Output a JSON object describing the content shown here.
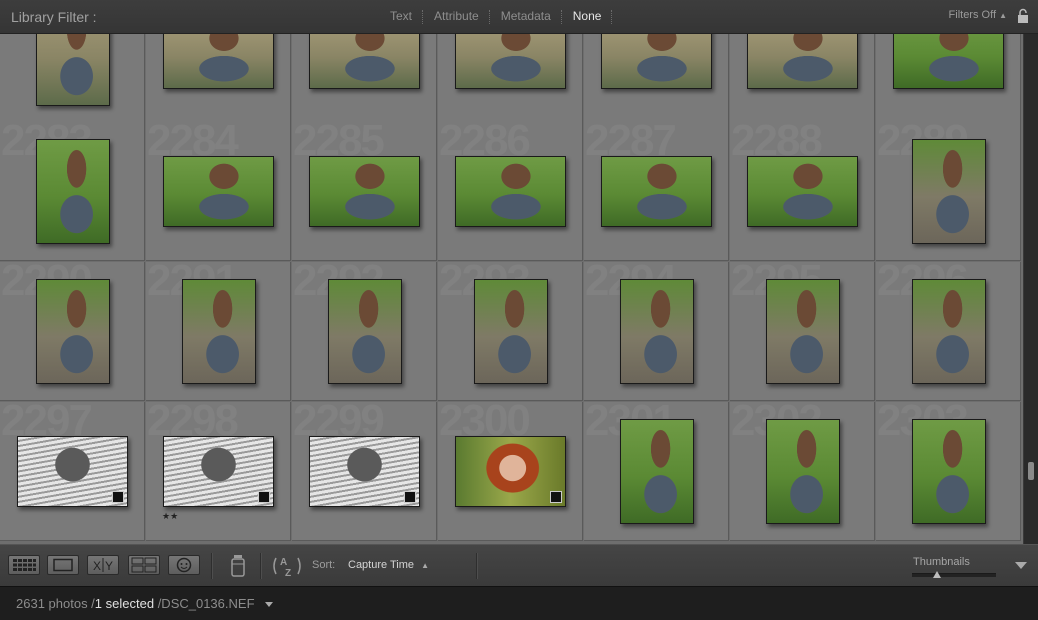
{
  "filter_bar": {
    "title": "Library Filter :",
    "options": [
      "Text",
      "Attribute",
      "Metadata",
      "None"
    ],
    "selected_option": "None",
    "preset": "Filters Off"
  },
  "grid": {
    "rows": [
      [
        {
          "number": "",
          "thumb": "grass",
          "orientation": "portrait",
          "badge": false
        },
        {
          "number": "",
          "thumb": "grass",
          "orientation": "landscape",
          "badge": false
        },
        {
          "number": "",
          "thumb": "grass",
          "orientation": "landscape",
          "badge": false
        },
        {
          "number": "",
          "thumb": "grass",
          "orientation": "landscape",
          "badge": false
        },
        {
          "number": "",
          "thumb": "grass",
          "orientation": "landscape",
          "badge": false
        },
        {
          "number": "",
          "thumb": "grass",
          "orientation": "landscape",
          "badge": false
        },
        {
          "number": "",
          "thumb": "green",
          "orientation": "landscape",
          "badge": false
        }
      ],
      [
        {
          "number": "2283",
          "thumb": "green",
          "orientation": "portrait",
          "badge": false
        },
        {
          "number": "2284",
          "thumb": "green",
          "orientation": "landscape",
          "badge": false
        },
        {
          "number": "2285",
          "thumb": "green",
          "orientation": "landscape",
          "badge": false
        },
        {
          "number": "2286",
          "thumb": "green",
          "orientation": "landscape",
          "badge": false
        },
        {
          "number": "2287",
          "thumb": "green",
          "orientation": "landscape",
          "badge": false
        },
        {
          "number": "2288",
          "thumb": "green",
          "orientation": "landscape",
          "badge": false
        },
        {
          "number": "2289",
          "thumb": "ground",
          "orientation": "portrait",
          "badge": false
        }
      ],
      [
        {
          "number": "2290",
          "thumb": "ground",
          "orientation": "portrait",
          "badge": false
        },
        {
          "number": "2291",
          "thumb": "ground",
          "orientation": "portrait",
          "badge": false
        },
        {
          "number": "2292",
          "thumb": "ground",
          "orientation": "portrait",
          "badge": false
        },
        {
          "number": "2293",
          "thumb": "ground",
          "orientation": "portrait",
          "badge": false
        },
        {
          "number": "2294",
          "thumb": "ground",
          "orientation": "portrait",
          "badge": false
        },
        {
          "number": "2295",
          "thumb": "ground",
          "orientation": "portrait",
          "badge": false
        },
        {
          "number": "2296",
          "thumb": "ground",
          "orientation": "portrait",
          "badge": false
        }
      ],
      [
        {
          "number": "2297",
          "thumb": "bw",
          "orientation": "landscape",
          "badge": true
        },
        {
          "number": "2298",
          "thumb": "bw",
          "orientation": "landscape",
          "badge": true,
          "stars": "★★"
        },
        {
          "number": "2299",
          "thumb": "bw",
          "orientation": "landscape",
          "badge": true
        },
        {
          "number": "2300",
          "thumb": "warm",
          "orientation": "landscape",
          "badge": true
        },
        {
          "number": "2301",
          "thumb": "green",
          "orientation": "portrait",
          "badge": false
        },
        {
          "number": "2302",
          "thumb": "green",
          "orientation": "portrait",
          "badge": false
        },
        {
          "number": "2303",
          "thumb": "green",
          "orientation": "portrait",
          "badge": false
        }
      ]
    ]
  },
  "toolbar": {
    "sort_label": "Sort:",
    "sort_value": "Capture Time",
    "thumbnails_label": "Thumbnails",
    "thumbnail_size": 0.3
  },
  "status_bar": {
    "count": "2631 photos /",
    "selected": "1 selected",
    "file": "/DSC_0136.NEF"
  }
}
